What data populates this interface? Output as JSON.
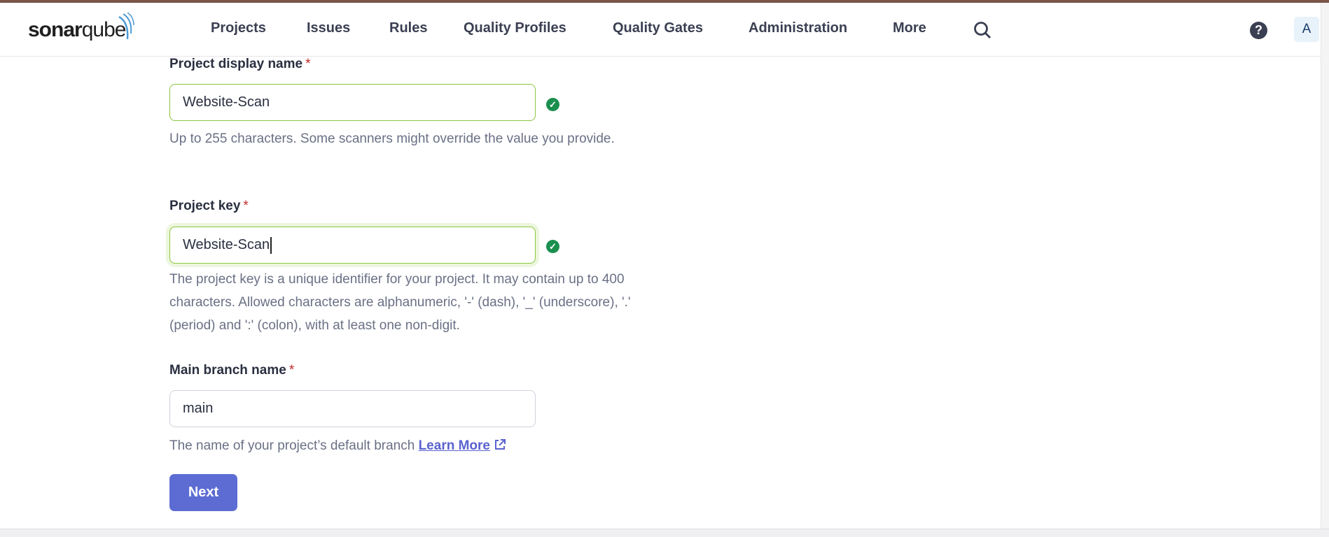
{
  "header": {
    "logo": "sonarqube",
    "nav": [
      "Projects",
      "Issues",
      "Rules",
      "Quality Profiles",
      "Quality Gates",
      "Administration",
      "More"
    ],
    "help": "?",
    "avatar": "A"
  },
  "form": {
    "display_name": {
      "label": "Project display name",
      "required": "*",
      "value": "Website-Scan",
      "hint": "Up to 255 characters. Some scanners might override the value you provide."
    },
    "key": {
      "label": "Project key",
      "required": "*",
      "value": "Website-Scan",
      "hint": "The project key is a unique identifier for your project. It may contain up to 400 characters. Allowed characters are alphanumeric, '-' (dash), '_' (underscore), '.' (period) and ':' (colon), with at least one non-digit."
    },
    "branch": {
      "label": "Main branch name",
      "required": "*",
      "value": "main",
      "hint": "The name of your project’s default branch",
      "link": "Learn More"
    },
    "next": "Next"
  },
  "colors": {
    "accent": "#5d6cd3",
    "valid": "#1a8f4e"
  }
}
